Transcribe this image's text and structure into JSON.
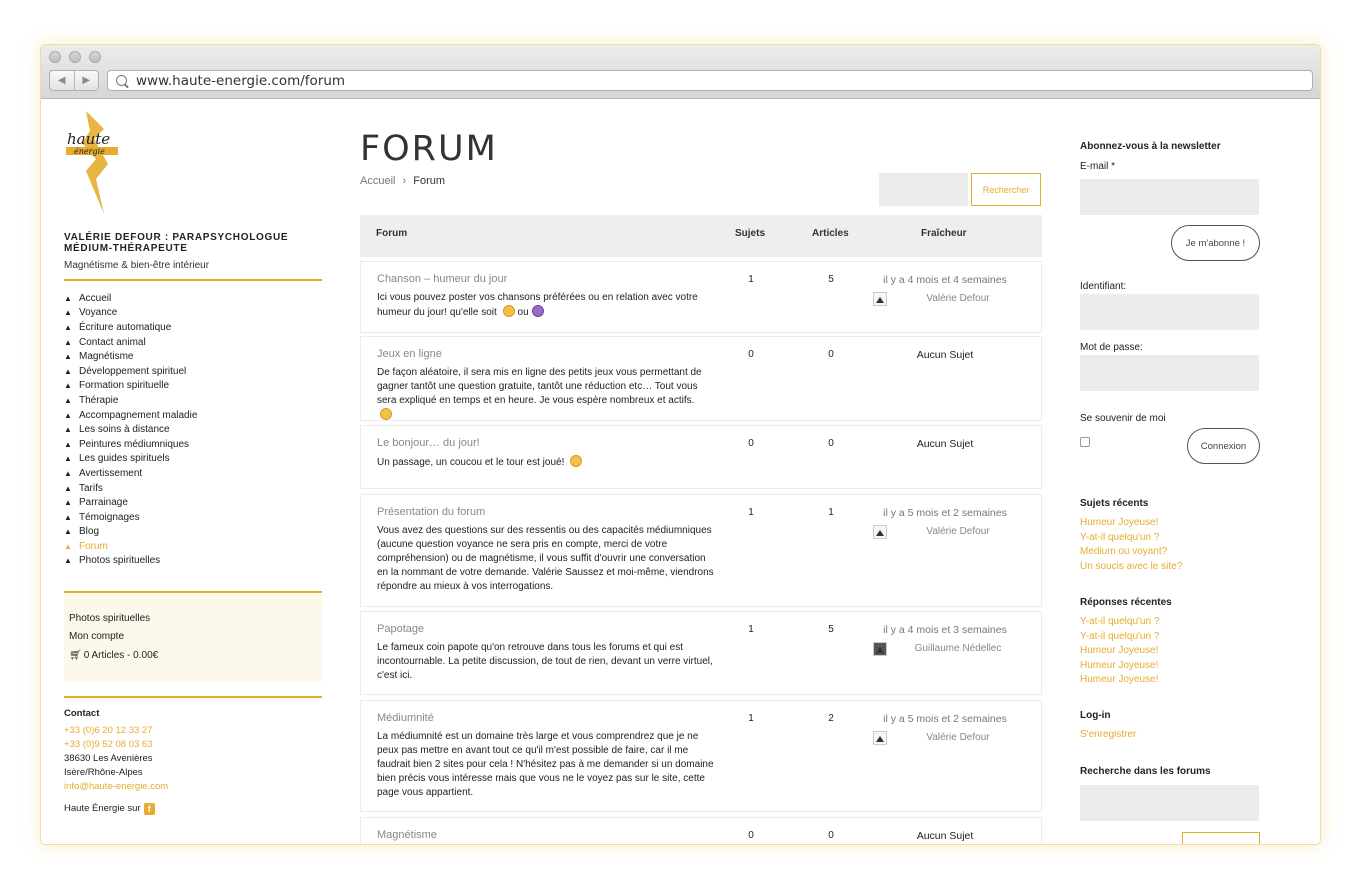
{
  "browser": {
    "url": "www.haute-energie.com/forum"
  },
  "site": {
    "logo_text_top": "haute",
    "logo_text_bottom": "énergie",
    "brand_line1": "VALÉRIE DEFOUR : PARAPSYCHOLOGUE",
    "brand_line2": "MÉDIUM-THÉRAPEUTE",
    "tagline": "Magnétisme & bien-être intérieur"
  },
  "menu": [
    {
      "label": "Accueil"
    },
    {
      "label": "Voyance"
    },
    {
      "label": "Écriture automatique"
    },
    {
      "label": "Contact animal"
    },
    {
      "label": "Magnétisme"
    },
    {
      "label": "Développement spirituel"
    },
    {
      "label": "Formation spirituelle"
    },
    {
      "label": "Thérapie"
    },
    {
      "label": "Accompagnement maladie"
    },
    {
      "label": "Les soins à distance"
    },
    {
      "label": "Peintures médiumniques"
    },
    {
      "label": "Les guides spirituels"
    },
    {
      "label": "Avertissement"
    },
    {
      "label": "Tarifs"
    },
    {
      "label": "Parrainage"
    },
    {
      "label": "Témoignages"
    },
    {
      "label": "Blog"
    },
    {
      "label": "Forum"
    },
    {
      "label": "Photos spirituelles"
    }
  ],
  "cart_box": {
    "photos": "Photos spirituelles",
    "account": "Mon compte",
    "cart": "0 Articles - 0.00€"
  },
  "contact": {
    "heading": "Contact",
    "phone1": "+33 (0)6 20 12 33 27",
    "phone2": "+33 (0)9 52 08 03 63",
    "address1": "38630 Les Avenières",
    "address2": "Isère/Rhône-Alpes",
    "email": "info@haute-energie.com",
    "social": "Haute Énergie sur",
    "social_icon": "f"
  },
  "main": {
    "title": "FORUM",
    "breadcrumb_home": "Accueil",
    "breadcrumb_sep": "›",
    "breadcrumb_current": "Forum",
    "search_button": "Rechercher",
    "columns": {
      "forum": "Forum",
      "topics": "Sujets",
      "posts": "Articles",
      "freshness": "Fraîcheur"
    }
  },
  "forums": [
    {
      "name": "Chanson – humeur du jour",
      "desc": "Ici vous pouvez poster vos chansons préférées ou en relation avec votre humeur du jour! qu'elle soit",
      "desc_mid": "ou",
      "topics": "1",
      "posts": "5",
      "freshness": "il y a 4 mois et 4 semaines",
      "author": "Valérie Defour"
    },
    {
      "name": "Jeux en ligne",
      "desc": "De façon aléatoire, il sera mis en ligne des petits jeux vous permettant de gagner tantôt une question gratuite, tantôt une réduction etc… Tout vous sera expliqué en temps et en heure. Je vous espère nombreux et actifs.",
      "topics": "0",
      "posts": "0",
      "freshness": "Aucun Sujet"
    },
    {
      "name": "Le bonjour… du jour!",
      "desc": "Un passage, un coucou et le tour est joué!",
      "topics": "0",
      "posts": "0",
      "freshness": "Aucun Sujet"
    },
    {
      "name": "Présentation du forum",
      "desc": "Vous avez des questions sur des ressentis ou des capacités médiumniques (aucune question voyance ne sera pris en compte, merci de votre compréhension) ou de magnétisme, il vous suffit d'ouvrir une conversation en la nommant de votre demande. Valérie Saussez et moi-même, viendrons répondre au mieux à vos interrogations.",
      "topics": "1",
      "posts": "1",
      "freshness": "il y a 5 mois et 2 semaines",
      "author": "Valérie Defour"
    },
    {
      "name": "Papotage",
      "desc": "Le fameux coin papote qu'on retrouve dans tous les forums et qui est incontournable. La petite discussion, de tout de rien, devant un verre virtuel, c'est ici.",
      "topics": "1",
      "posts": "5",
      "freshness": "il y a 4 mois et 3 semaines",
      "author": "Guillaume Nédellec"
    },
    {
      "name": "Médiumnité",
      "desc": "La médiumnité est un domaine très large et vous comprendrez que je ne peux pas mettre en avant tout ce qu'il m'est possible de faire, car il me faudrait bien 2 sites pour cela ! N'hésitez pas à me demander si un domaine bien précis vous intéresse mais que vous ne le voyez pas sur le site, cette page vous appartient.",
      "topics": "1",
      "posts": "2",
      "freshness": "il y a 5 mois et 2 semaines",
      "author": "Valérie Defour"
    },
    {
      "name": "Magnétisme",
      "desc": "",
      "topics": "0",
      "posts": "0",
      "freshness": "Aucun Sujet"
    }
  ],
  "right": {
    "newsletter_heading": "Abonnez-vous à la newsletter",
    "email_label": "E-mail *",
    "subscribe_button": "Je m'abonne !",
    "username_label": "Identifiant:",
    "password_label": "Mot de passe:",
    "remember_label": "Se souvenir de moi",
    "login_button": "Connexion",
    "recent_topics_heading": "Sujets récents",
    "recent_topics": [
      "Humeur Joyeuse!",
      "Y-at-il quelqu'un ?",
      "Medium ou voyant?",
      "Un soucis avec le site?"
    ],
    "recent_replies_heading": "Réponses récentes",
    "recent_replies": [
      "Y-at-il quelqu'un ?",
      "Y-at-il quelqu'un ?",
      "Humeur Joyeuse!",
      "Humeur Joyeuse!",
      "Humeur Joyeuse!"
    ],
    "login_heading": "Log-in",
    "register_link": "S'enregistrer",
    "forum_search_heading": "Recherche dans les forums"
  },
  "colors": {
    "accent": "#e6ac2e",
    "row_border": "#ececec",
    "header_bg": "#eeeeee"
  }
}
